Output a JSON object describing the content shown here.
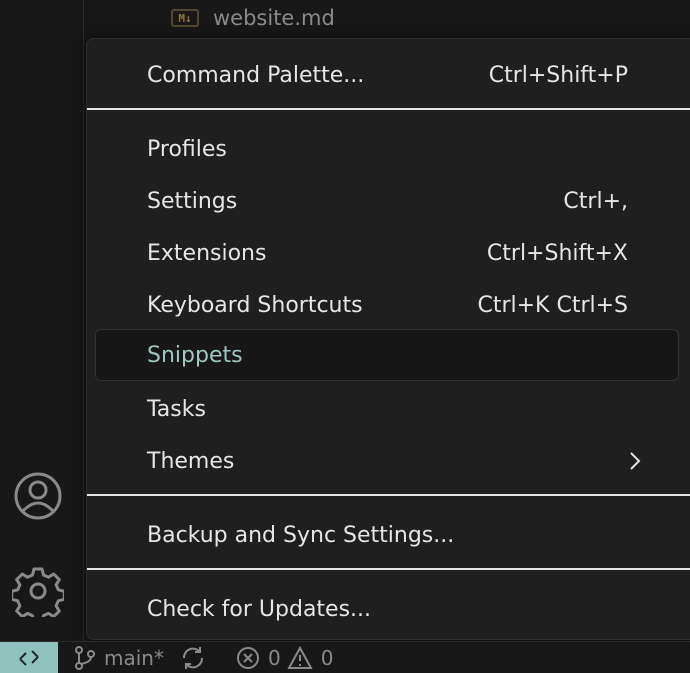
{
  "explorer": {
    "file": {
      "icon": "markdown-file-icon",
      "icon_text": "M↓",
      "name": "website.md"
    }
  },
  "activity_bar": {
    "accounts_icon": "accounts-icon",
    "manage_icon": "gear-icon"
  },
  "menu": {
    "items": [
      {
        "label": "Command Palette...",
        "shortcut": "Ctrl+Shift+P"
      },
      {
        "label": "Profiles",
        "shortcut": ""
      },
      {
        "label": "Settings",
        "shortcut": "Ctrl+,"
      },
      {
        "label": "Extensions",
        "shortcut": "Ctrl+Shift+X"
      },
      {
        "label": "Keyboard Shortcuts",
        "shortcut": "Ctrl+K Ctrl+S"
      },
      {
        "label": "Snippets",
        "shortcut": "",
        "highlighted": true
      },
      {
        "label": "Tasks",
        "shortcut": ""
      },
      {
        "label": "Themes",
        "shortcut": "",
        "submenu": true
      },
      {
        "label": "Backup and Sync Settings...",
        "shortcut": ""
      },
      {
        "label": "Check for Updates...",
        "shortcut": ""
      }
    ]
  },
  "statusbar": {
    "remote_icon": "remote-icon",
    "branch": "main*",
    "branch_icon": "git-branch-icon",
    "sync_icon": "sync-icon",
    "errors": "0",
    "warnings": "0",
    "error_icon": "error-icon",
    "warning_icon": "warning-icon"
  },
  "colors": {
    "accent_remote": "#8fc2bd",
    "highlight_text": "#9fc6c0",
    "menu_bg": "#1f1f1f",
    "background": "#181818"
  }
}
